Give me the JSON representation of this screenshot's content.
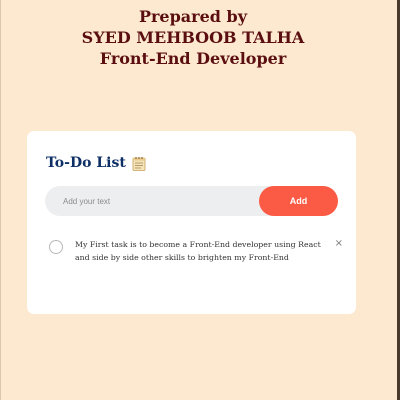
{
  "header": {
    "line1": "Prepared by",
    "line2": "SYED MEHBOOB TALHA",
    "line3": "Front-End Developer",
    "color": "#5a0e10"
  },
  "todo": {
    "title": "To-Do List",
    "title_icon": "notepad-icon",
    "input_placeholder": "Add your text",
    "input_value": "",
    "add_label": "Add",
    "accent_color": "#fb5a44",
    "tasks": [
      {
        "text": "My First task is to become a Front-End developer using React and side by side other skills to brighten my Front-End",
        "checked": false,
        "delete_label": "×"
      }
    ]
  },
  "colors": {
    "page_background": "#fde9d0",
    "card_background": "#ffffff",
    "title_color": "#0e2f66"
  }
}
